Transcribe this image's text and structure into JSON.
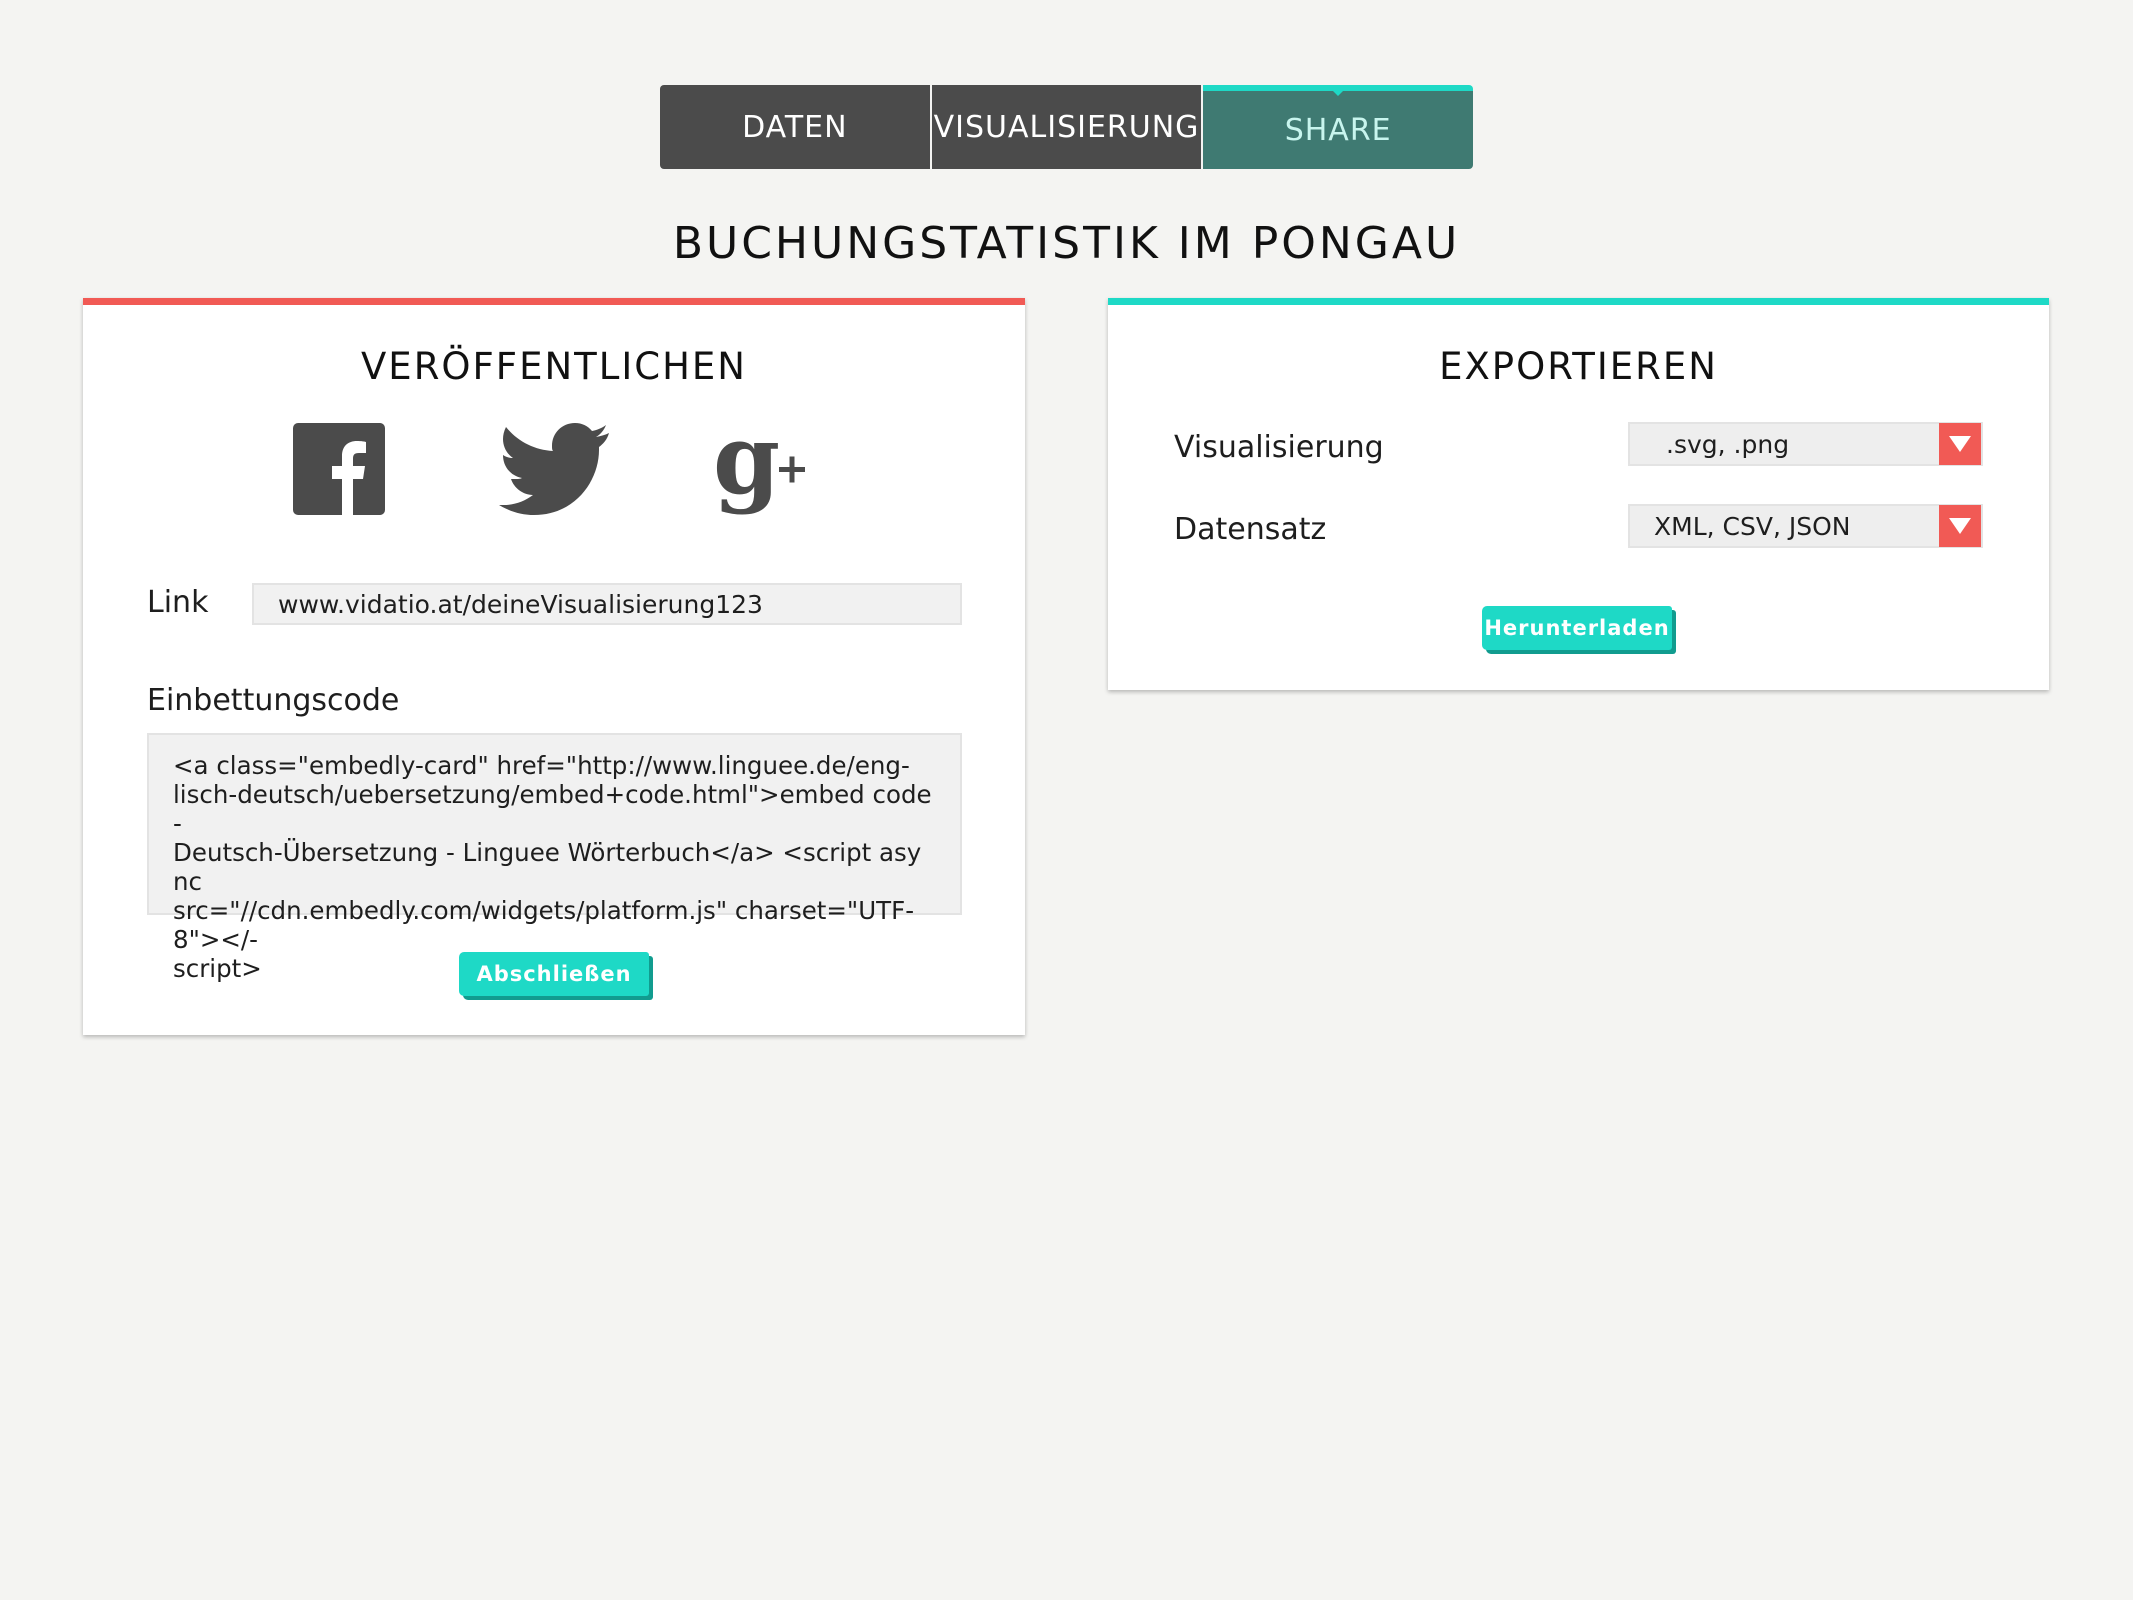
{
  "tabs": [
    {
      "label": "DATEN"
    },
    {
      "label": "VISUALISIERUNG"
    },
    {
      "label": "SHARE"
    }
  ],
  "page_title": "BUCHUNGSTATISTIK IM PONGAU",
  "publish": {
    "heading": "VERÖFFENTLICHEN",
    "social_icons": [
      "facebook-icon",
      "twitter-icon",
      "google-plus-icon"
    ],
    "link_label": "Link",
    "link_value": "www.vidatio.at/deineVisualisierung123",
    "embed_label": "Einbettungscode",
    "embed_code": "<a class=\"embedly-card\" href=\"http://www.linguee.de/eng-\nlisch-deutsch/uebersetzung/embed+code.html\">embed code -\nDeutsch-Übersetzung - Linguee Wörterbuch</a> <script async\nsrc=\"//cdn.embedly.com/widgets/platform.js\" charset=\"UTF-8\"></-\nscript>",
    "finish_button": "Abschließen"
  },
  "export": {
    "heading": "EXPORTIEREN",
    "rows": [
      {
        "label": "Visualisierung",
        "value": ".svg, .png"
      },
      {
        "label": "Datensatz",
        "value": "XML, CSV, JSON"
      }
    ],
    "download_button": "Herunterladen"
  },
  "colors": {
    "accent_teal": "#1ed9c6",
    "accent_red": "#f15a55",
    "tab_dark": "#4b4b4b",
    "tab_active": "#3f7a72",
    "icon_gray": "#4b4b4b"
  }
}
